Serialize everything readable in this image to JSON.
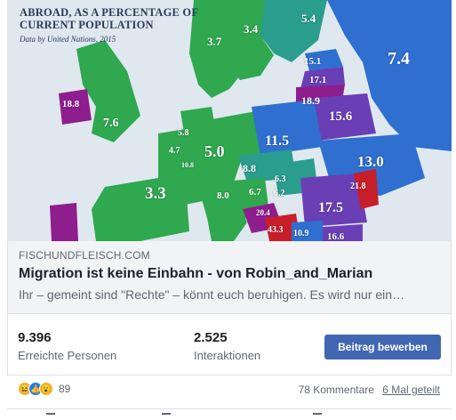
{
  "map": {
    "title_line1": "ABROAD, AS A PERCENTAGE OF",
    "title_line2": "CURRENT POPULATION",
    "subtitle": "Data by United Nations, 2015",
    "labels": [
      "5.4",
      "3.4",
      "3.7",
      "7.4",
      "15.1",
      "17.1",
      "18.9",
      "18.8",
      "15.6",
      "7.6",
      "11.5",
      "5.8",
      "4.7",
      "5.0",
      "10.8",
      "13.0",
      "8.8",
      "6.3",
      "21.8",
      "3.3",
      "8.0",
      "6.7",
      "6.2",
      "17.5",
      "20.4",
      "43.3",
      "10.9",
      "16.6"
    ]
  },
  "link": {
    "domain": "FISCHUNDFLEISCH.COM",
    "headline": "Migration ist keine Einbahn - von Robin_and_Marian",
    "description": "Ihr – gemeint sind \"Rechte\" – könnt euch beruhigen. Es wird nur ein…"
  },
  "stats": {
    "reach_value": "9.396",
    "reach_label": "Erreichte Personen",
    "interactions_value": "2.525",
    "interactions_label": "Interaktionen",
    "promote_label": "Beitrag bewerben"
  },
  "engagement": {
    "reaction_icons": [
      "haha-icon",
      "like-icon",
      "wow-icon"
    ],
    "reaction_count": "89",
    "comments": "78 Kommentare",
    "shares": "6 Mal geteilt"
  },
  "colors": {
    "accent": "#4267b2",
    "sea": "#dfe8ef",
    "green": "#2fa84f",
    "teal": "#2a9d8f",
    "blue": "#2f6fd0",
    "purple": "#6a3fb5",
    "magenta": "#8e1d8e",
    "red": "#c81e2a"
  }
}
